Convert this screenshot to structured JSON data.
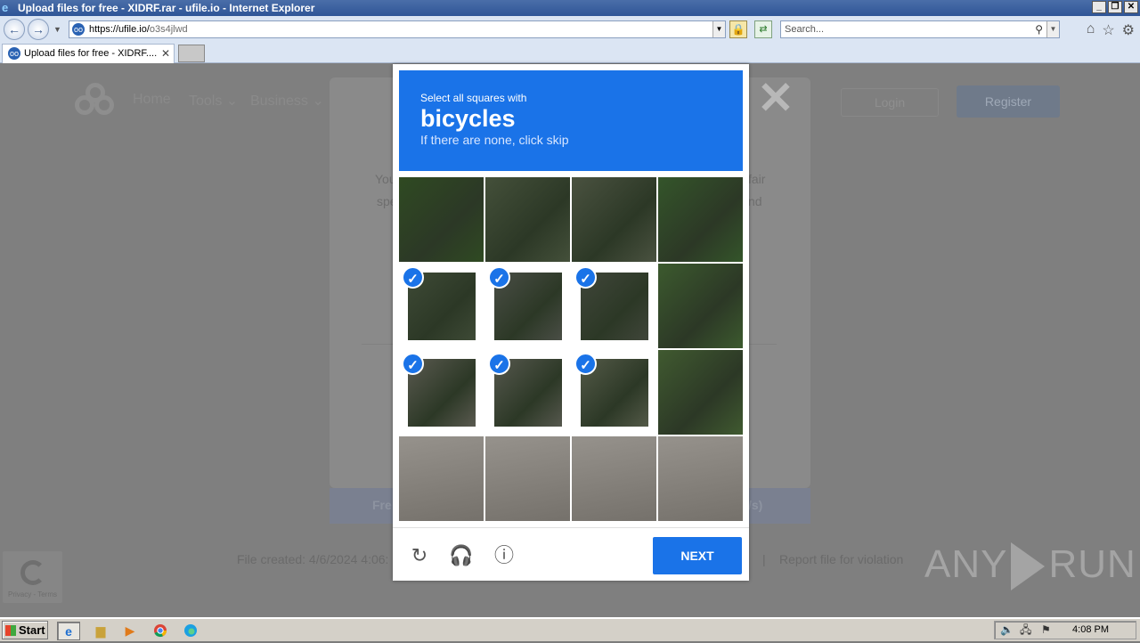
{
  "window": {
    "title": "Upload files for free - XIDRF.rar - ufile.io - Internet Explorer"
  },
  "address": {
    "host": "https://ufile.io/",
    "path": "o3s4jlwd"
  },
  "search": {
    "placeholder": "Search..."
  },
  "tab": {
    "label": "Upload files for free - XIDRF...."
  },
  "site": {
    "nav": [
      "Home",
      "Tools ⌄",
      "Business ⌄"
    ],
    "login": "Login",
    "register": "Register",
    "bg_texts": [
      "You",
      "fair",
      "spe",
      "nd",
      "Fre",
      "/s)"
    ],
    "file_created": "File created: 4/6/2024 4:06:",
    "report": "Report file for violation",
    "recaptcha_badge": "Privacy - Terms"
  },
  "captcha": {
    "instruction": "Select all squares with",
    "object": "bicycles",
    "hint": "If there are none, click skip",
    "selected": [
      4,
      5,
      6,
      8,
      9,
      10
    ],
    "next_label": "NEXT",
    "icons": [
      "reload-icon",
      "audio-icon",
      "info-icon"
    ]
  },
  "watermark": {
    "left": "ANY",
    "right": "RUN"
  },
  "taskbar": {
    "start": "Start",
    "clock": "4:08 PM"
  }
}
